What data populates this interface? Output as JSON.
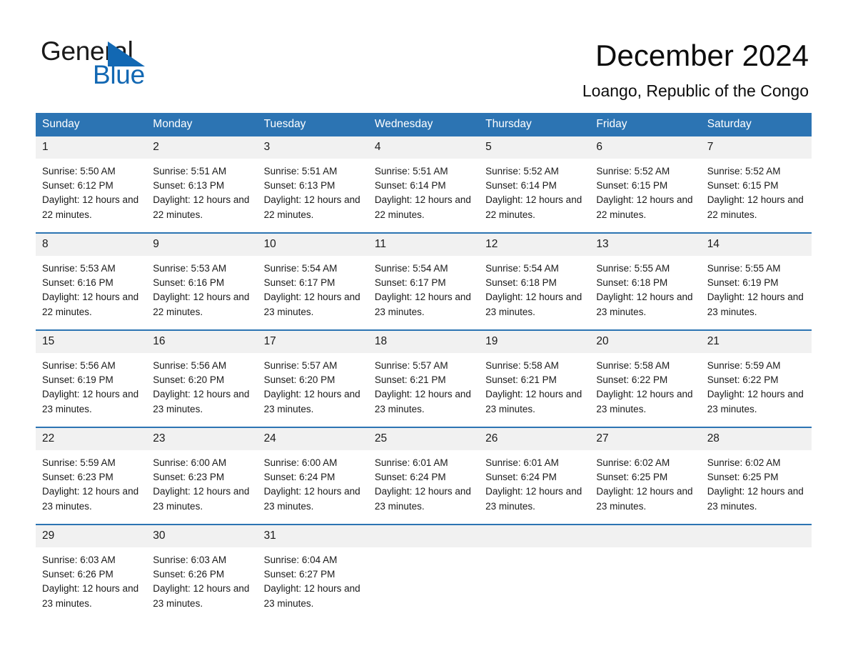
{
  "brand": {
    "word_general": "General",
    "word_blue": "Blue",
    "triangle_color": "#1268b3"
  },
  "header": {
    "title": "December 2024",
    "subtitle": "Loango, Republic of the Congo"
  },
  "theme": {
    "header_blue": "#2c74b3",
    "daynum_gray": "#f1f1f1",
    "text": "#1a1a1a"
  },
  "calendar": {
    "weekday_headers": [
      "Sunday",
      "Monday",
      "Tuesday",
      "Wednesday",
      "Thursday",
      "Friday",
      "Saturday"
    ],
    "weeks": [
      [
        {
          "day": "1",
          "sunrise": "Sunrise: 5:50 AM",
          "sunset": "Sunset: 6:12 PM",
          "daylight": "Daylight: 12 hours and 22 minutes."
        },
        {
          "day": "2",
          "sunrise": "Sunrise: 5:51 AM",
          "sunset": "Sunset: 6:13 PM",
          "daylight": "Daylight: 12 hours and 22 minutes."
        },
        {
          "day": "3",
          "sunrise": "Sunrise: 5:51 AM",
          "sunset": "Sunset: 6:13 PM",
          "daylight": "Daylight: 12 hours and 22 minutes."
        },
        {
          "day": "4",
          "sunrise": "Sunrise: 5:51 AM",
          "sunset": "Sunset: 6:14 PM",
          "daylight": "Daylight: 12 hours and 22 minutes."
        },
        {
          "day": "5",
          "sunrise": "Sunrise: 5:52 AM",
          "sunset": "Sunset: 6:14 PM",
          "daylight": "Daylight: 12 hours and 22 minutes."
        },
        {
          "day": "6",
          "sunrise": "Sunrise: 5:52 AM",
          "sunset": "Sunset: 6:15 PM",
          "daylight": "Daylight: 12 hours and 22 minutes."
        },
        {
          "day": "7",
          "sunrise": "Sunrise: 5:52 AM",
          "sunset": "Sunset: 6:15 PM",
          "daylight": "Daylight: 12 hours and 22 minutes."
        }
      ],
      [
        {
          "day": "8",
          "sunrise": "Sunrise: 5:53 AM",
          "sunset": "Sunset: 6:16 PM",
          "daylight": "Daylight: 12 hours and 22 minutes."
        },
        {
          "day": "9",
          "sunrise": "Sunrise: 5:53 AM",
          "sunset": "Sunset: 6:16 PM",
          "daylight": "Daylight: 12 hours and 22 minutes."
        },
        {
          "day": "10",
          "sunrise": "Sunrise: 5:54 AM",
          "sunset": "Sunset: 6:17 PM",
          "daylight": "Daylight: 12 hours and 23 minutes."
        },
        {
          "day": "11",
          "sunrise": "Sunrise: 5:54 AM",
          "sunset": "Sunset: 6:17 PM",
          "daylight": "Daylight: 12 hours and 23 minutes."
        },
        {
          "day": "12",
          "sunrise": "Sunrise: 5:54 AM",
          "sunset": "Sunset: 6:18 PM",
          "daylight": "Daylight: 12 hours and 23 minutes."
        },
        {
          "day": "13",
          "sunrise": "Sunrise: 5:55 AM",
          "sunset": "Sunset: 6:18 PM",
          "daylight": "Daylight: 12 hours and 23 minutes."
        },
        {
          "day": "14",
          "sunrise": "Sunrise: 5:55 AM",
          "sunset": "Sunset: 6:19 PM",
          "daylight": "Daylight: 12 hours and 23 minutes."
        }
      ],
      [
        {
          "day": "15",
          "sunrise": "Sunrise: 5:56 AM",
          "sunset": "Sunset: 6:19 PM",
          "daylight": "Daylight: 12 hours and 23 minutes."
        },
        {
          "day": "16",
          "sunrise": "Sunrise: 5:56 AM",
          "sunset": "Sunset: 6:20 PM",
          "daylight": "Daylight: 12 hours and 23 minutes."
        },
        {
          "day": "17",
          "sunrise": "Sunrise: 5:57 AM",
          "sunset": "Sunset: 6:20 PM",
          "daylight": "Daylight: 12 hours and 23 minutes."
        },
        {
          "day": "18",
          "sunrise": "Sunrise: 5:57 AM",
          "sunset": "Sunset: 6:21 PM",
          "daylight": "Daylight: 12 hours and 23 minutes."
        },
        {
          "day": "19",
          "sunrise": "Sunrise: 5:58 AM",
          "sunset": "Sunset: 6:21 PM",
          "daylight": "Daylight: 12 hours and 23 minutes."
        },
        {
          "day": "20",
          "sunrise": "Sunrise: 5:58 AM",
          "sunset": "Sunset: 6:22 PM",
          "daylight": "Daylight: 12 hours and 23 minutes."
        },
        {
          "day": "21",
          "sunrise": "Sunrise: 5:59 AM",
          "sunset": "Sunset: 6:22 PM",
          "daylight": "Daylight: 12 hours and 23 minutes."
        }
      ],
      [
        {
          "day": "22",
          "sunrise": "Sunrise: 5:59 AM",
          "sunset": "Sunset: 6:23 PM",
          "daylight": "Daylight: 12 hours and 23 minutes."
        },
        {
          "day": "23",
          "sunrise": "Sunrise: 6:00 AM",
          "sunset": "Sunset: 6:23 PM",
          "daylight": "Daylight: 12 hours and 23 minutes."
        },
        {
          "day": "24",
          "sunrise": "Sunrise: 6:00 AM",
          "sunset": "Sunset: 6:24 PM",
          "daylight": "Daylight: 12 hours and 23 minutes."
        },
        {
          "day": "25",
          "sunrise": "Sunrise: 6:01 AM",
          "sunset": "Sunset: 6:24 PM",
          "daylight": "Daylight: 12 hours and 23 minutes."
        },
        {
          "day": "26",
          "sunrise": "Sunrise: 6:01 AM",
          "sunset": "Sunset: 6:24 PM",
          "daylight": "Daylight: 12 hours and 23 minutes."
        },
        {
          "day": "27",
          "sunrise": "Sunrise: 6:02 AM",
          "sunset": "Sunset: 6:25 PM",
          "daylight": "Daylight: 12 hours and 23 minutes."
        },
        {
          "day": "28",
          "sunrise": "Sunrise: 6:02 AM",
          "sunset": "Sunset: 6:25 PM",
          "daylight": "Daylight: 12 hours and 23 minutes."
        }
      ],
      [
        {
          "day": "29",
          "sunrise": "Sunrise: 6:03 AM",
          "sunset": "Sunset: 6:26 PM",
          "daylight": "Daylight: 12 hours and 23 minutes."
        },
        {
          "day": "30",
          "sunrise": "Sunrise: 6:03 AM",
          "sunset": "Sunset: 6:26 PM",
          "daylight": "Daylight: 12 hours and 23 minutes."
        },
        {
          "day": "31",
          "sunrise": "Sunrise: 6:04 AM",
          "sunset": "Sunset: 6:27 PM",
          "daylight": "Daylight: 12 hours and 23 minutes."
        },
        {
          "day": "",
          "sunrise": "",
          "sunset": "",
          "daylight": ""
        },
        {
          "day": "",
          "sunrise": "",
          "sunset": "",
          "daylight": ""
        },
        {
          "day": "",
          "sunrise": "",
          "sunset": "",
          "daylight": ""
        },
        {
          "day": "",
          "sunrise": "",
          "sunset": "",
          "daylight": ""
        }
      ]
    ]
  }
}
